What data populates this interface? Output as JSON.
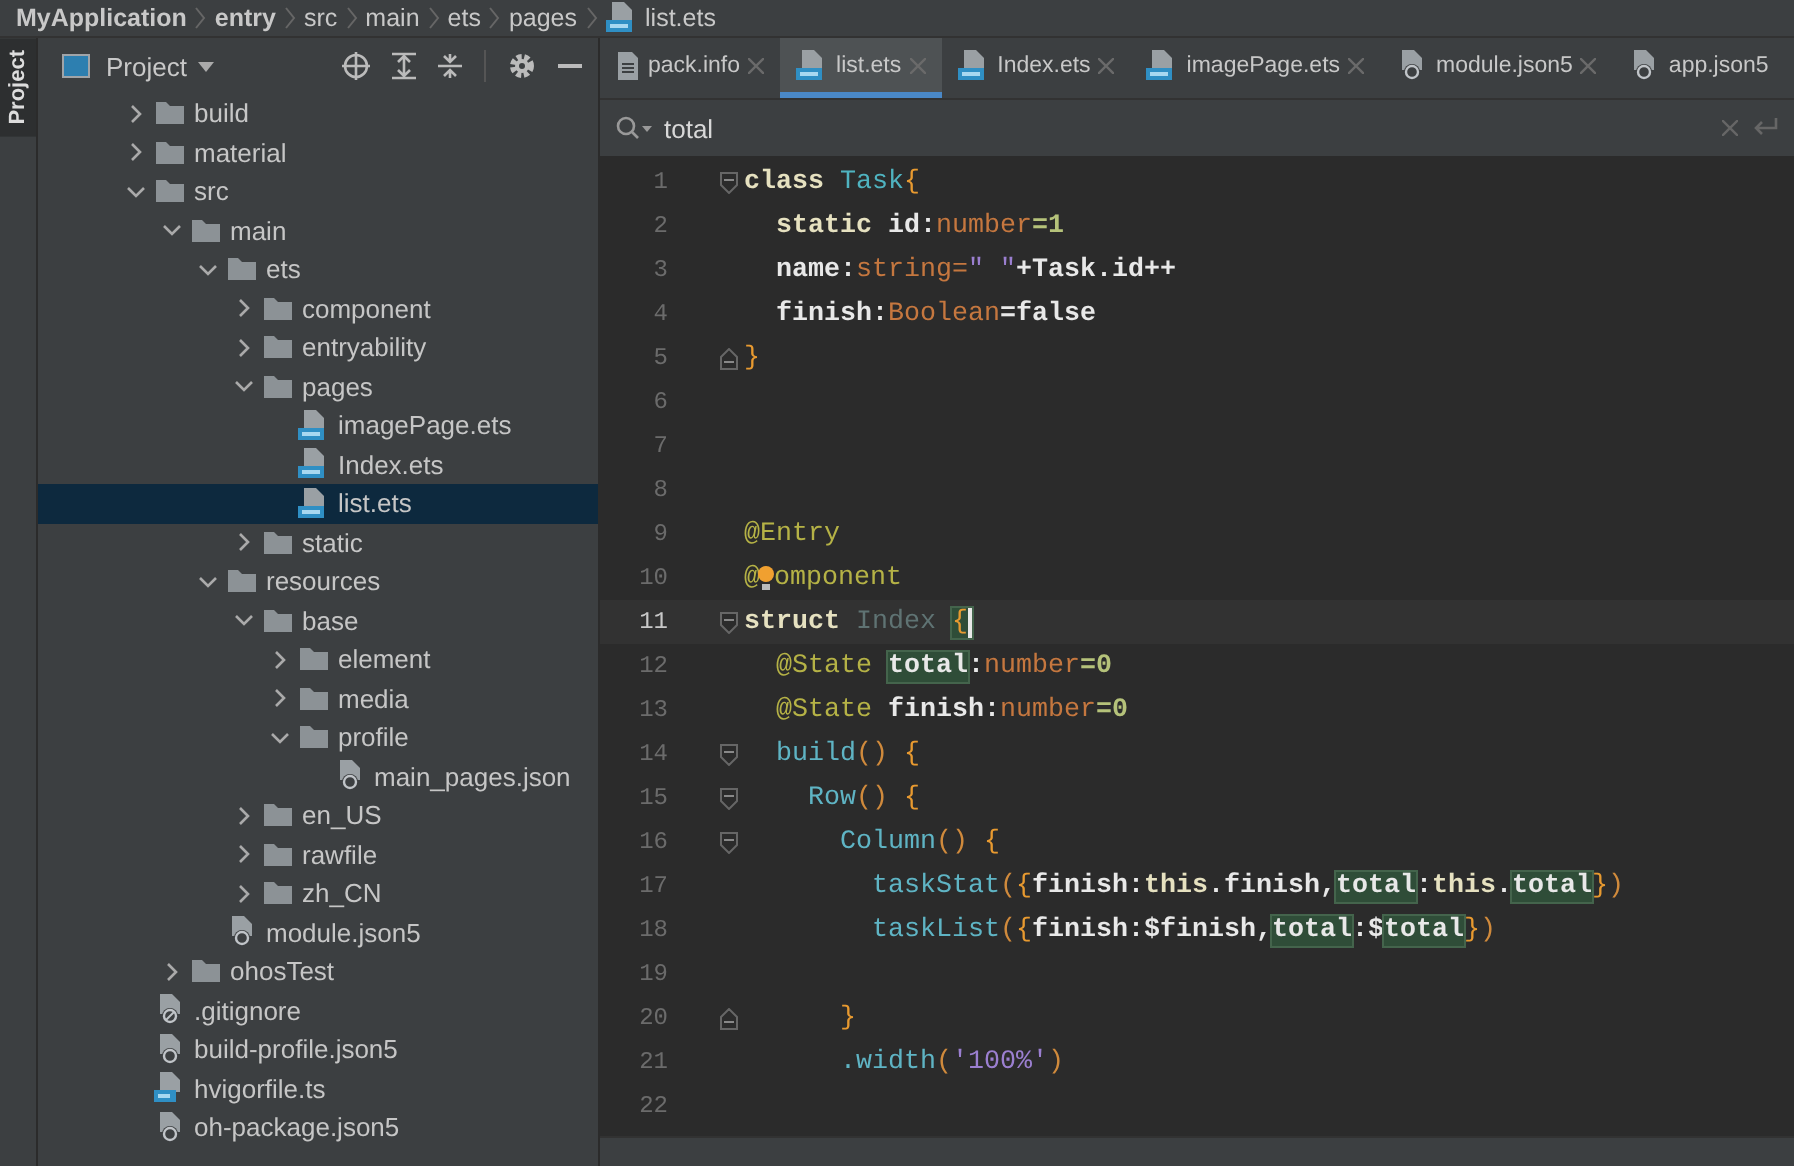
{
  "breadcrumb": [
    {
      "label": "MyApplication",
      "bold": true,
      "kind": "folder"
    },
    {
      "label": "entry",
      "bold": true,
      "kind": "folder"
    },
    {
      "label": "src",
      "bold": false,
      "kind": "folder"
    },
    {
      "label": "main",
      "bold": false,
      "kind": "folder"
    },
    {
      "label": "ets",
      "bold": false,
      "kind": "folder"
    },
    {
      "label": "pages",
      "bold": false,
      "kind": "folder"
    },
    {
      "label": "list.ets",
      "bold": false,
      "kind": "ets"
    }
  ],
  "side_strip": {
    "tabs": [
      {
        "label": "Project",
        "selected": true
      }
    ]
  },
  "project": {
    "title": "Project",
    "tree": [
      {
        "label": "build",
        "kind": "folder",
        "expanded": false,
        "selected": false
      },
      {
        "label": "material",
        "kind": "folder",
        "expanded": false,
        "selected": false
      },
      {
        "label": "src",
        "kind": "folder",
        "expanded": true,
        "selected": false,
        "children": [
          {
            "label": "main",
            "kind": "folder",
            "expanded": true,
            "selected": false,
            "children": [
              {
                "label": "ets",
                "kind": "folder",
                "expanded": true,
                "selected": false,
                "children": [
                  {
                    "label": "component",
                    "kind": "folder",
                    "expanded": false,
                    "selected": false
                  },
                  {
                    "label": "entryability",
                    "kind": "folder",
                    "expanded": false,
                    "selected": false
                  },
                  {
                    "label": "pages",
                    "kind": "folder",
                    "expanded": true,
                    "selected": false,
                    "children": [
                      {
                        "label": "imagePage.ets",
                        "kind": "ets",
                        "selected": false
                      },
                      {
                        "label": "Index.ets",
                        "kind": "ets",
                        "selected": false
                      },
                      {
                        "label": "list.ets",
                        "kind": "ets",
                        "selected": true
                      }
                    ]
                  },
                  {
                    "label": "static",
                    "kind": "folder",
                    "expanded": false,
                    "selected": false
                  }
                ]
              },
              {
                "label": "resources",
                "kind": "folder",
                "expanded": true,
                "selected": false,
                "children": [
                  {
                    "label": "base",
                    "kind": "folder",
                    "expanded": true,
                    "selected": false,
                    "children": [
                      {
                        "label": "element",
                        "kind": "folder",
                        "expanded": false,
                        "selected": false
                      },
                      {
                        "label": "media",
                        "kind": "folder",
                        "expanded": false,
                        "selected": false
                      },
                      {
                        "label": "profile",
                        "kind": "folder",
                        "expanded": true,
                        "selected": false,
                        "children": [
                          {
                            "label": "main_pages.json",
                            "kind": "json",
                            "selected": false
                          }
                        ]
                      }
                    ]
                  },
                  {
                    "label": "en_US",
                    "kind": "folder",
                    "expanded": false,
                    "selected": false
                  },
                  {
                    "label": "rawfile",
                    "kind": "folder",
                    "expanded": false,
                    "selected": false
                  },
                  {
                    "label": "zh_CN",
                    "kind": "folder",
                    "expanded": false,
                    "selected": false
                  }
                ]
              },
              {
                "label": "module.json5",
                "kind": "json",
                "selected": false
              }
            ]
          },
          {
            "label": "ohosTest",
            "kind": "folder",
            "expanded": false,
            "selected": false
          }
        ]
      },
      {
        "label": ".gitignore",
        "kind": "ignore",
        "selected": false
      },
      {
        "label": "build-profile.json5",
        "kind": "json",
        "selected": false
      },
      {
        "label": "hvigorfile.ts",
        "kind": "ts",
        "selected": false
      },
      {
        "label": "oh-package.json5",
        "kind": "json",
        "selected": false
      }
    ]
  },
  "editor_tabs": [
    {
      "label": "pack.info",
      "kind": "text",
      "selected": false,
      "closable": true
    },
    {
      "label": "list.ets",
      "kind": "ets",
      "selected": true,
      "closable": true
    },
    {
      "label": "Index.ets",
      "kind": "ets",
      "selected": false,
      "closable": true
    },
    {
      "label": "imagePage.ets",
      "kind": "ets",
      "selected": false,
      "closable": true
    },
    {
      "label": "module.json5",
      "kind": "json",
      "selected": false,
      "closable": true
    },
    {
      "label": "app.json5",
      "kind": "json",
      "selected": false,
      "closable": false
    }
  ],
  "find_bar": {
    "value": "total"
  },
  "code_lines": [
    {
      "number": "1",
      "fold_start": true,
      "current": false,
      "segments": [
        {
          "text": "class ",
          "kind": "kw"
        },
        {
          "text": "Task",
          "kind": "cls"
        },
        {
          "text": "{",
          "kind": "brace"
        }
      ]
    },
    {
      "number": "2",
      "current": false,
      "segments": [
        {
          "text": "  static ",
          "kind": "kw"
        },
        {
          "text": "id:",
          "kind": "plain"
        },
        {
          "text": "number",
          "kind": "type"
        },
        {
          "text": "=1",
          "kind": "num"
        }
      ]
    },
    {
      "number": "3",
      "current": false,
      "segments": [
        {
          "text": "  name:",
          "kind": "plain"
        },
        {
          "text": "string=",
          "kind": "type"
        },
        {
          "text": "\" \"",
          "kind": "str"
        },
        {
          "text": "+Task.id++",
          "kind": "plain"
        }
      ]
    },
    {
      "number": "4",
      "current": false,
      "segments": [
        {
          "text": "  finish:",
          "kind": "plain"
        },
        {
          "text": "Boolean",
          "kind": "type"
        },
        {
          "text": "=false",
          "kind": "plain"
        }
      ]
    },
    {
      "number": "5",
      "fold_end": true,
      "current": false,
      "segments": [
        {
          "text": "}",
          "kind": "brace"
        }
      ]
    },
    {
      "number": "6",
      "current": false
    },
    {
      "number": "7",
      "current": false
    },
    {
      "number": "8",
      "current": false
    },
    {
      "number": "9",
      "current": false,
      "segments": [
        {
          "text": "@Entry",
          "kind": "deco"
        }
      ]
    },
    {
      "number": "10",
      "current": false,
      "bulb": true,
      "segments": [
        {
          "text": "@",
          "kind": "deco"
        },
        {
          "text": "omponent",
          "kind": "deco"
        }
      ]
    },
    {
      "number": "11",
      "fold_start": true,
      "current": true,
      "segments": [
        {
          "text": "struct ",
          "kind": "kw"
        },
        {
          "text": "Index ",
          "kind": "dim"
        },
        {
          "text": "{",
          "kind": "brace",
          "match": true,
          "caret": true
        }
      ]
    },
    {
      "number": "12",
      "current": false,
      "segments": [
        {
          "text": "  @State ",
          "kind": "deco"
        },
        {
          "text": "total",
          "kind": "plain",
          "match": true
        },
        {
          "text": ":",
          "kind": "plain"
        },
        {
          "text": "number",
          "kind": "type"
        },
        {
          "text": "=0",
          "kind": "num"
        }
      ]
    },
    {
      "number": "13",
      "current": false,
      "segments": [
        {
          "text": "  @State ",
          "kind": "deco"
        },
        {
          "text": "finish:",
          "kind": "plain"
        },
        {
          "text": "number",
          "kind": "type"
        },
        {
          "text": "=0",
          "kind": "num"
        }
      ]
    },
    {
      "number": "14",
      "fold_start": true,
      "current": false,
      "segments": [
        {
          "text": "  build",
          "kind": "fn"
        },
        {
          "text": "() ",
          "kind": "punct"
        },
        {
          "text": "{",
          "kind": "brace"
        }
      ]
    },
    {
      "number": "15",
      "fold_start": true,
      "current": false,
      "segments": [
        {
          "text": "    Row",
          "kind": "fn"
        },
        {
          "text": "() ",
          "kind": "punct"
        },
        {
          "text": "{",
          "kind": "brace"
        }
      ]
    },
    {
      "number": "16",
      "fold_start": true,
      "current": false,
      "segments": [
        {
          "text": "      Column",
          "kind": "fn"
        },
        {
          "text": "() ",
          "kind": "punct"
        },
        {
          "text": "{",
          "kind": "brace"
        }
      ]
    },
    {
      "number": "17",
      "current": false,
      "segments": [
        {
          "text": "        taskStat",
          "kind": "fn"
        },
        {
          "text": "(",
          "kind": "punct"
        },
        {
          "text": "{",
          "kind": "brace"
        },
        {
          "text": "finish:",
          "kind": "plain"
        },
        {
          "text": "this",
          "kind": "kw"
        },
        {
          "text": ".finish,",
          "kind": "plain"
        },
        {
          "text": "total",
          "kind": "plain",
          "match": true
        },
        {
          "text": ":",
          "kind": "plain"
        },
        {
          "text": "this",
          "kind": "kw"
        },
        {
          "text": ".",
          "kind": "plain"
        },
        {
          "text": "total",
          "kind": "plain",
          "match": true
        },
        {
          "text": "}",
          "kind": "brace"
        },
        {
          "text": ")",
          "kind": "punct"
        }
      ]
    },
    {
      "number": "18",
      "current": false,
      "segments": [
        {
          "text": "        taskList",
          "kind": "fn"
        },
        {
          "text": "(",
          "kind": "punct"
        },
        {
          "text": "{",
          "kind": "brace"
        },
        {
          "text": "finish:$finish,",
          "kind": "plain"
        },
        {
          "text": "total",
          "kind": "plain",
          "match": true
        },
        {
          "text": ":$",
          "kind": "plain"
        },
        {
          "text": "total",
          "kind": "plain",
          "match": true
        },
        {
          "text": "}",
          "kind": "brace"
        },
        {
          "text": ")",
          "kind": "punct"
        }
      ]
    },
    {
      "number": "19",
      "current": false
    },
    {
      "number": "20",
      "fold_end": true,
      "current": false,
      "segments": [
        {
          "text": "      }",
          "kind": "brace"
        }
      ]
    },
    {
      "number": "21",
      "current": false,
      "segments": [
        {
          "text": "      .width",
          "kind": "fn"
        },
        {
          "text": "(",
          "kind": "punct"
        },
        {
          "text": "'100%'",
          "kind": "str"
        },
        {
          "text": ")",
          "kind": "punct"
        }
      ]
    },
    {
      "number": "22",
      "current": false
    }
  ]
}
